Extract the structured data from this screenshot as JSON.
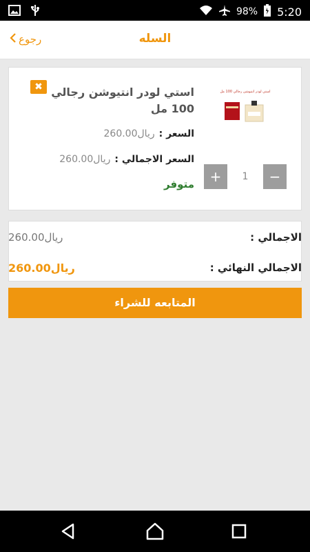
{
  "status_bar": {
    "battery": "98%",
    "time": "5:20"
  },
  "header": {
    "title": "السله",
    "back_label": "رجوع"
  },
  "product": {
    "name": "استي لودر انتيوشن رجالي 100 مل",
    "thumb_caption": "استي لودر انتيوشن رجالي 100 مل",
    "price_label": "السعر :",
    "price_value": "260.00ريال",
    "total_label": "السعر الاجمالي :",
    "total_value": "260.00ريال",
    "stock_status": "متوفر",
    "quantity": "1",
    "plus": "+",
    "minus": "−"
  },
  "summary": {
    "total_label": "الاجمالي :",
    "total_value": "260.00ريال",
    "final_label": "الاجمالي النهائي :",
    "final_value": "260.00ريال"
  },
  "checkout": {
    "label": "المتابعه للشراء"
  },
  "colors": {
    "accent": "#f0960e",
    "in_stock": "#2f7d2f",
    "stepper": "#9d9d9d"
  },
  "icons": [
    "image-icon",
    "usb-icon",
    "wifi-icon",
    "airplane-icon",
    "battery-icon",
    "chevron-right-icon",
    "close-icon",
    "back-nav-icon",
    "home-nav-icon",
    "recents-nav-icon"
  ]
}
